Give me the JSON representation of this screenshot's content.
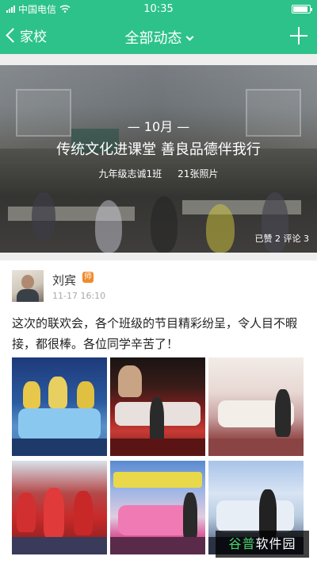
{
  "status_bar": {
    "carrier": "中国电信",
    "time": "10:35",
    "battery_level": 0.9
  },
  "nav": {
    "back_label": "家校",
    "title": "全部动态"
  },
  "album": {
    "month": "— 10月 —",
    "title": "传统文化进课堂 善良品德伴我行",
    "class_name": "九年级志诚1班",
    "photo_count": "21张照片",
    "stats": "已赞 2  评论 3"
  },
  "post": {
    "author": "刘宾",
    "badge": "师",
    "timestamp": "11-17 16:10",
    "text": "这次的联欢会，各个班级的节目精彩纷呈，令人目不暇接，都很棒。各位同学辛苦了！"
  },
  "watermark": {
    "text_part1": "谷普",
    "text_part2": "软件园"
  },
  "colors": {
    "header": "#2dc28a",
    "badge": "#f08a2a"
  },
  "icons": [
    "wifi-icon",
    "signal-icon",
    "battery-icon",
    "back-chevron-icon",
    "dropdown-caret-icon",
    "plus-icon"
  ]
}
